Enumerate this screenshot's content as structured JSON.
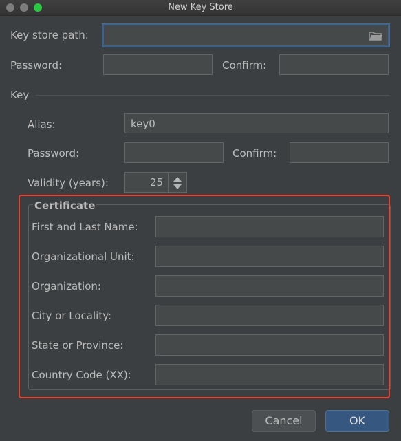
{
  "window": {
    "title": "New Key Store"
  },
  "keystore": {
    "path_label": "Key store path:",
    "path_value": "",
    "password_label": "Password:",
    "confirm_label": "Confirm:"
  },
  "key": {
    "section_label": "Key",
    "alias_label": "Alias:",
    "alias_value": "key0",
    "password_label": "Password:",
    "confirm_label": "Confirm:",
    "validity_label": "Validity (years):",
    "validity_value": "25"
  },
  "certificate": {
    "title": "Certificate",
    "fields": [
      {
        "label": "First and Last Name:",
        "value": ""
      },
      {
        "label": "Organizational Unit:",
        "value": ""
      },
      {
        "label": "Organization:",
        "value": ""
      },
      {
        "label": "City or Locality:",
        "value": ""
      },
      {
        "label": "State or Province:",
        "value": ""
      },
      {
        "label": "Country Code (XX):",
        "value": ""
      }
    ]
  },
  "buttons": {
    "cancel": "Cancel",
    "ok": "OK"
  },
  "icons": {
    "browse": "folder-icon",
    "spinner_up": "arrow-up-icon",
    "spinner_down": "arrow-down-icon"
  },
  "colors": {
    "background": "#3c3f41",
    "field_bg": "#45494a",
    "ok_button": "#365880",
    "highlight": "#e8412f",
    "traffic_green": "#28c840"
  }
}
